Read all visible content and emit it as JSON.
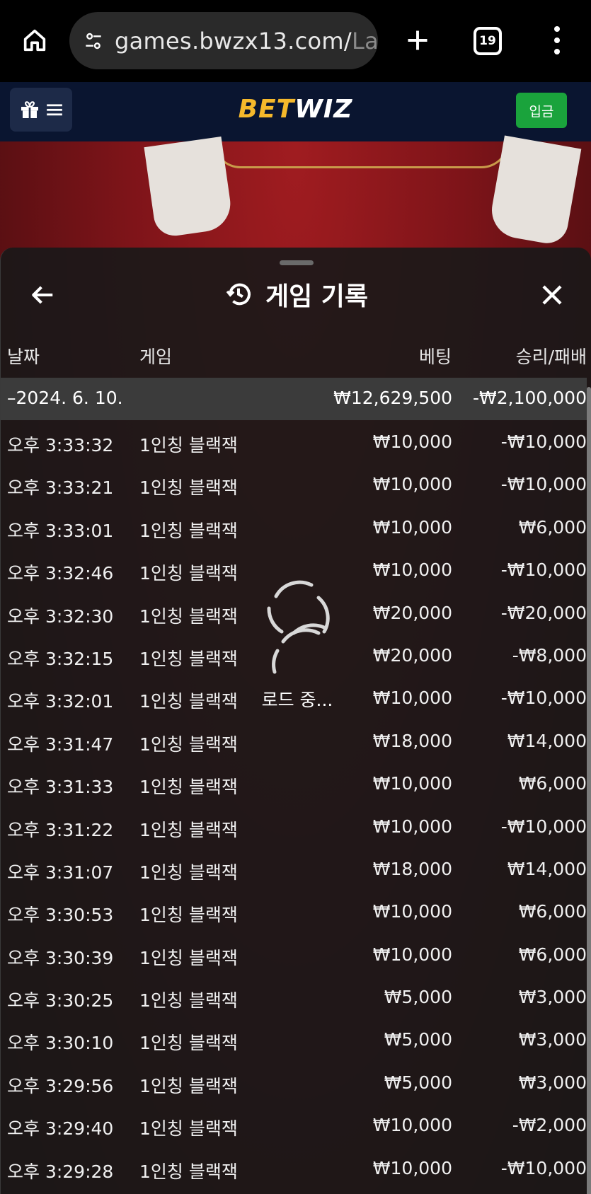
{
  "browser": {
    "url_main": "games.bwzx13.com/",
    "url_fade": "La",
    "tab_count": "19"
  },
  "site": {
    "logo_bet": "BET",
    "logo_wiz": "WIZ",
    "deposit_label": "입금"
  },
  "panel": {
    "title": "게임 기록",
    "columns": {
      "date": "날짜",
      "game": "게임",
      "bet": "베팅",
      "win_loss": "승리/패배"
    },
    "date_group": {
      "date": "–2024. 6. 10.",
      "bet_total": "₩12,629,500",
      "win_loss_total": "-₩2,100,000"
    },
    "loading_label": "로드 중..."
  },
  "rows": [
    {
      "time": "오후 3:33:32",
      "game": "1인칭 블랙잭",
      "bet": "₩10,000",
      "win": "-₩10,000"
    },
    {
      "time": "오후 3:33:21",
      "game": "1인칭 블랙잭",
      "bet": "₩10,000",
      "win": "-₩10,000"
    },
    {
      "time": "오후 3:33:01",
      "game": "1인칭 블랙잭",
      "bet": "₩10,000",
      "win": "₩6,000"
    },
    {
      "time": "오후 3:32:46",
      "game": "1인칭 블랙잭",
      "bet": "₩10,000",
      "win": "-₩10,000"
    },
    {
      "time": "오후 3:32:30",
      "game": "1인칭 블랙잭",
      "bet": "₩20,000",
      "win": "-₩20,000"
    },
    {
      "time": "오후 3:32:15",
      "game": "1인칭 블랙잭",
      "bet": "₩20,000",
      "win": "-₩8,000"
    },
    {
      "time": "오후 3:32:01",
      "game": "1인칭 블랙잭",
      "bet": "₩10,000",
      "win": "-₩10,000"
    },
    {
      "time": "오후 3:31:47",
      "game": "1인칭 블랙잭",
      "bet": "₩18,000",
      "win": "₩14,000"
    },
    {
      "time": "오후 3:31:33",
      "game": "1인칭 블랙잭",
      "bet": "₩10,000",
      "win": "₩6,000"
    },
    {
      "time": "오후 3:31:22",
      "game": "1인칭 블랙잭",
      "bet": "₩10,000",
      "win": "-₩10,000"
    },
    {
      "time": "오후 3:31:07",
      "game": "1인칭 블랙잭",
      "bet": "₩18,000",
      "win": "₩14,000"
    },
    {
      "time": "오후 3:30:53",
      "game": "1인칭 블랙잭",
      "bet": "₩10,000",
      "win": "₩6,000"
    },
    {
      "time": "오후 3:30:39",
      "game": "1인칭 블랙잭",
      "bet": "₩10,000",
      "win": "₩6,000"
    },
    {
      "time": "오후 3:30:25",
      "game": "1인칭 블랙잭",
      "bet": "₩5,000",
      "win": "₩3,000"
    },
    {
      "time": "오후 3:30:10",
      "game": "1인칭 블랙잭",
      "bet": "₩5,000",
      "win": "₩3,000"
    },
    {
      "time": "오후 3:29:56",
      "game": "1인칭 블랙잭",
      "bet": "₩5,000",
      "win": "₩3,000"
    },
    {
      "time": "오후 3:29:40",
      "game": "1인칭 블랙잭",
      "bet": "₩10,000",
      "win": "-₩2,000"
    },
    {
      "time": "오후 3:29:28",
      "game": "1인칭 블랙잭",
      "bet": "₩10,000",
      "win": "-₩10,000"
    }
  ],
  "icons": {
    "home": "home-icon",
    "site_settings": "tune-icon",
    "new_tab": "plus-icon",
    "overflow": "more-vert-icon",
    "gift": "gift-icon",
    "hamburger": "hamburger-icon",
    "back": "arrow-left-icon",
    "history": "history-icon",
    "close": "close-icon",
    "loading": "spinner-icon"
  },
  "colors": {
    "brand_gold": "#f6b92b",
    "deposit_green": "#1aa33c",
    "header_navy": "#0a1530"
  }
}
